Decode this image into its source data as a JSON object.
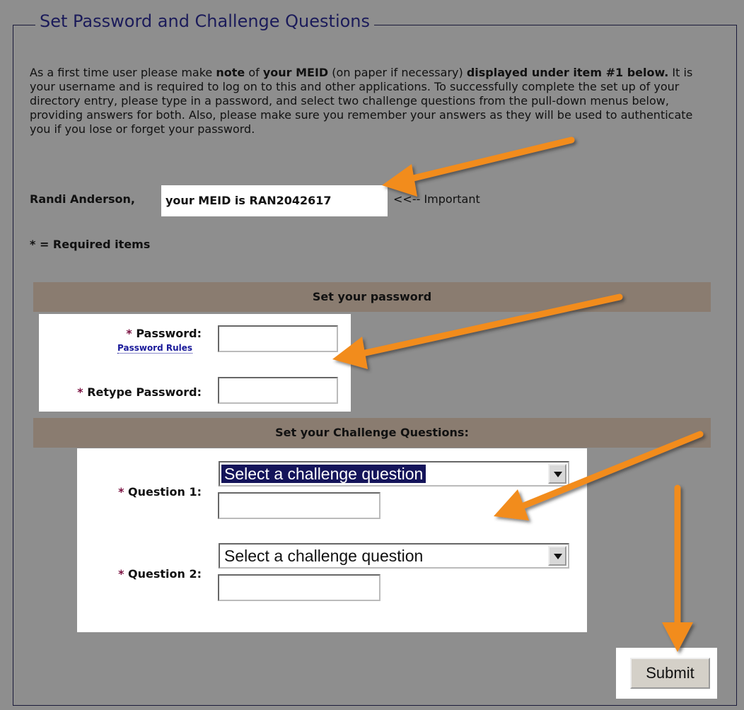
{
  "page": {
    "legend": "Set Password and Challenge Questions",
    "intro": {
      "part1": "As a first time user please make ",
      "bold1": "note",
      "part2": " of ",
      "bold2": "your MEID",
      "part3": " (on paper if necessary) ",
      "bold3": "displayed under item #1 below.",
      "part4": " It is your username and is required to log on to this and other applications. To successfully complete the set up of your directory entry, please type in a password, and select two challenge questions from the pull-down menus below, providing answers for both. Also, please make sure you remember your answers as they will be used to authenticate you if you lose or forget your password."
    },
    "meid": {
      "name": "Randi Anderson,",
      "text": "your MEID is RAN2042617",
      "note": "<<-- Important"
    },
    "required_note": "* = Required items"
  },
  "password_section": {
    "header": "Set your password",
    "star": "*",
    "password_label": "Password:",
    "rules_link": "Password Rules",
    "password_value": "",
    "retype_label": "Retype Password:",
    "retype_value": ""
  },
  "challenge_section": {
    "header": "Set your Challenge Questions:",
    "star": "*",
    "q1_label": "Question 1:",
    "q1_select": "Select a challenge question",
    "q1_answer": "",
    "q2_label": "Question 2:",
    "q2_select": "Select a challenge question",
    "q2_answer": ""
  },
  "submit_label": "Submit",
  "colors": {
    "arrow": "#f28c1e",
    "section_bar": "#8a7c70",
    "legend_text": "#1b1b5a",
    "select_highlight": "#14145a"
  }
}
